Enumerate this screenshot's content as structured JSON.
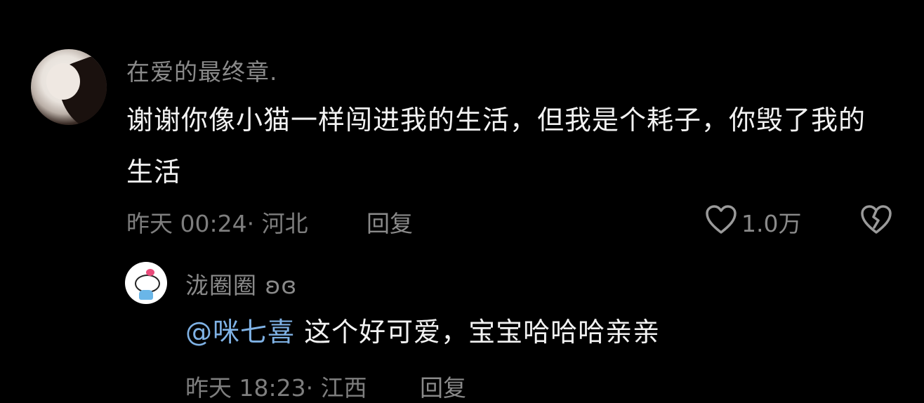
{
  "comment": {
    "username": "在爱的最终章.",
    "text": "谢谢你像小猫一样闯进我的生活，但我是个耗子，你毁了我的生活",
    "time": "昨天 00:24",
    "location": "· 河北",
    "reply_label": "回复",
    "like_count": "1.0万",
    "icons": [
      "avatar",
      "heart-icon",
      "broken-heart-icon"
    ]
  },
  "reply": {
    "username": "泷圈圈 ʚɞ",
    "mention": "@咪七喜",
    "text": " 这个好可爱，宝宝哈哈哈亲亲",
    "time": "昨天 18:23",
    "location": "· 江西",
    "reply_label": "回复",
    "icons": [
      "hello-kitty-avatar"
    ]
  },
  "colors": {
    "background": "#000000",
    "text": "#f2f2f2",
    "muted": "#8a8a8a",
    "mention": "#7fb2e5"
  }
}
